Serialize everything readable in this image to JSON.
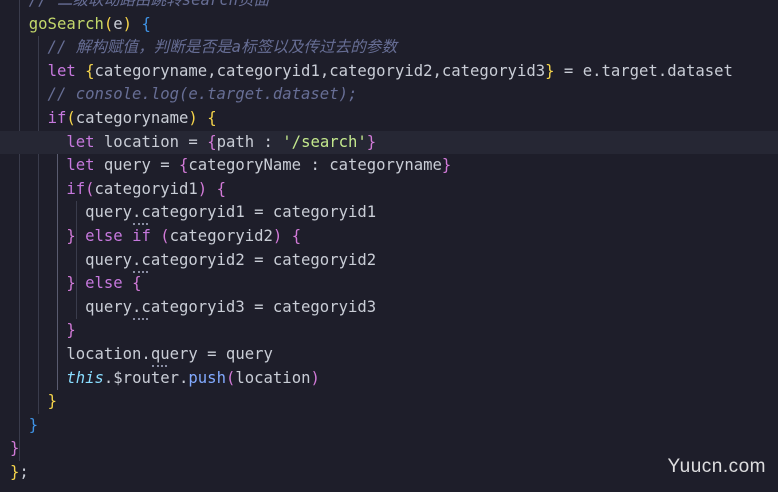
{
  "editor": {
    "lines": [
      {
        "tokens": [
          {
            "t": "  // 二级联动路由跳转search页面",
            "c": "cm"
          }
        ]
      },
      {
        "tokens": [
          {
            "t": "  ",
            "c": "pn"
          },
          {
            "t": "goSearch",
            "c": "fn2"
          },
          {
            "t": "(",
            "c": "b1"
          },
          {
            "t": "e",
            "c": "var"
          },
          {
            "t": ")",
            "c": "b1"
          },
          {
            "t": " ",
            "c": "pn"
          },
          {
            "t": "{",
            "c": "b3"
          }
        ]
      },
      {
        "tokens": [
          {
            "t": "    // 解构赋值，判断是否是a标签以及传过去的参数",
            "c": "cm"
          }
        ]
      },
      {
        "tokens": [
          {
            "t": "    ",
            "c": "pn"
          },
          {
            "t": "let",
            "c": "kw"
          },
          {
            "t": " ",
            "c": "pn"
          },
          {
            "t": "{",
            "c": "b1"
          },
          {
            "t": "categoryname,categoryid1,categoryid2,categoryid3",
            "c": "var"
          },
          {
            "t": "}",
            "c": "b1"
          },
          {
            "t": " = e.target.dataset",
            "c": "var"
          }
        ]
      },
      {
        "tokens": [
          {
            "t": "    // console.log(e.target.dataset);",
            "c": "cm"
          }
        ]
      },
      {
        "tokens": [
          {
            "t": "    ",
            "c": "pn"
          },
          {
            "t": "if",
            "c": "kw"
          },
          {
            "t": "(",
            "c": "b1"
          },
          {
            "t": "categoryname",
            "c": "var"
          },
          {
            "t": ")",
            "c": "b1"
          },
          {
            "t": " ",
            "c": "pn"
          },
          {
            "t": "{",
            "c": "b1"
          }
        ]
      },
      {
        "current": true,
        "tokens": [
          {
            "t": "      ",
            "c": "pn"
          },
          {
            "t": "let",
            "c": "kw"
          },
          {
            "t": " location = ",
            "c": "var"
          },
          {
            "t": "{",
            "c": "b2"
          },
          {
            "t": "path : ",
            "c": "var"
          },
          {
            "t": "'/search'",
            "c": "str"
          },
          {
            "t": "}",
            "c": "b2"
          }
        ]
      },
      {
        "tokens": [
          {
            "t": "      ",
            "c": "pn"
          },
          {
            "t": "let",
            "c": "kw"
          },
          {
            "t": " query = ",
            "c": "var"
          },
          {
            "t": "{",
            "c": "b2"
          },
          {
            "t": "categoryName : categoryname",
            "c": "var"
          },
          {
            "t": "}",
            "c": "b2"
          }
        ]
      },
      {
        "tokens": [
          {
            "t": "      ",
            "c": "pn"
          },
          {
            "t": "if",
            "c": "kw"
          },
          {
            "t": "(",
            "c": "b2"
          },
          {
            "t": "categoryid1",
            "c": "var"
          },
          {
            "t": ")",
            "c": "b2"
          },
          {
            "t": " ",
            "c": "pn"
          },
          {
            "t": "{",
            "c": "b2"
          }
        ]
      },
      {
        "tokens": [
          {
            "t": "        query.categoryid1 = categoryid1",
            "c": "var"
          }
        ]
      },
      {
        "tokens": [
          {
            "t": "      ",
            "c": "pn"
          },
          {
            "t": "}",
            "c": "b2"
          },
          {
            "t": " ",
            "c": "pn"
          },
          {
            "t": "else",
            "c": "kw"
          },
          {
            "t": " ",
            "c": "pn"
          },
          {
            "t": "if",
            "c": "kw"
          },
          {
            "t": " ",
            "c": "pn"
          },
          {
            "t": "(",
            "c": "b2"
          },
          {
            "t": "categoryid2",
            "c": "var"
          },
          {
            "t": ")",
            "c": "b2"
          },
          {
            "t": " ",
            "c": "pn"
          },
          {
            "t": "{",
            "c": "b2"
          }
        ]
      },
      {
        "tokens": [
          {
            "t": "        query.categoryid2 = categoryid2",
            "c": "var"
          }
        ]
      },
      {
        "tokens": [
          {
            "t": "      ",
            "c": "pn"
          },
          {
            "t": "}",
            "c": "b2"
          },
          {
            "t": " ",
            "c": "pn"
          },
          {
            "t": "else",
            "c": "kw"
          },
          {
            "t": " ",
            "c": "pn"
          },
          {
            "t": "{",
            "c": "b2"
          }
        ]
      },
      {
        "tokens": [
          {
            "t": "        query.categoryid3 = categoryid3",
            "c": "var"
          }
        ]
      },
      {
        "tokens": [
          {
            "t": "      ",
            "c": "pn"
          },
          {
            "t": "}",
            "c": "b2"
          }
        ]
      },
      {
        "tokens": [
          {
            "t": "      location.query = query",
            "c": "var"
          }
        ]
      },
      {
        "tokens": [
          {
            "t": "      ",
            "c": "pn"
          },
          {
            "t": "this",
            "c": "this"
          },
          {
            "t": ".$router.",
            "c": "var"
          },
          {
            "t": "push",
            "c": "fn"
          },
          {
            "t": "(",
            "c": "b2"
          },
          {
            "t": "location",
            "c": "var"
          },
          {
            "t": ")",
            "c": "b2"
          }
        ]
      },
      {
        "tokens": [
          {
            "t": "    ",
            "c": "pn"
          },
          {
            "t": "}",
            "c": "b1"
          }
        ]
      },
      {
        "tokens": [
          {
            "t": "  ",
            "c": "pn"
          },
          {
            "t": "}",
            "c": "b3"
          }
        ]
      },
      {
        "tokens": [
          {
            "t": "}",
            "c": "b2"
          }
        ]
      },
      {
        "tokens": [
          {
            "t": "}",
            "c": "b1"
          },
          {
            "t": ";",
            "c": "pn"
          }
        ]
      }
    ]
  },
  "watermark": "Yuucn.com",
  "colors": {
    "background": "#1e1e2a",
    "current_line": "#262734",
    "keyword": "#c678dd",
    "string": "#c3e88d",
    "comment": "#676e95",
    "bracket_gold": "#f6d54b",
    "bracket_pink": "#d27ad8",
    "bracket_blue": "#3f93e6"
  }
}
